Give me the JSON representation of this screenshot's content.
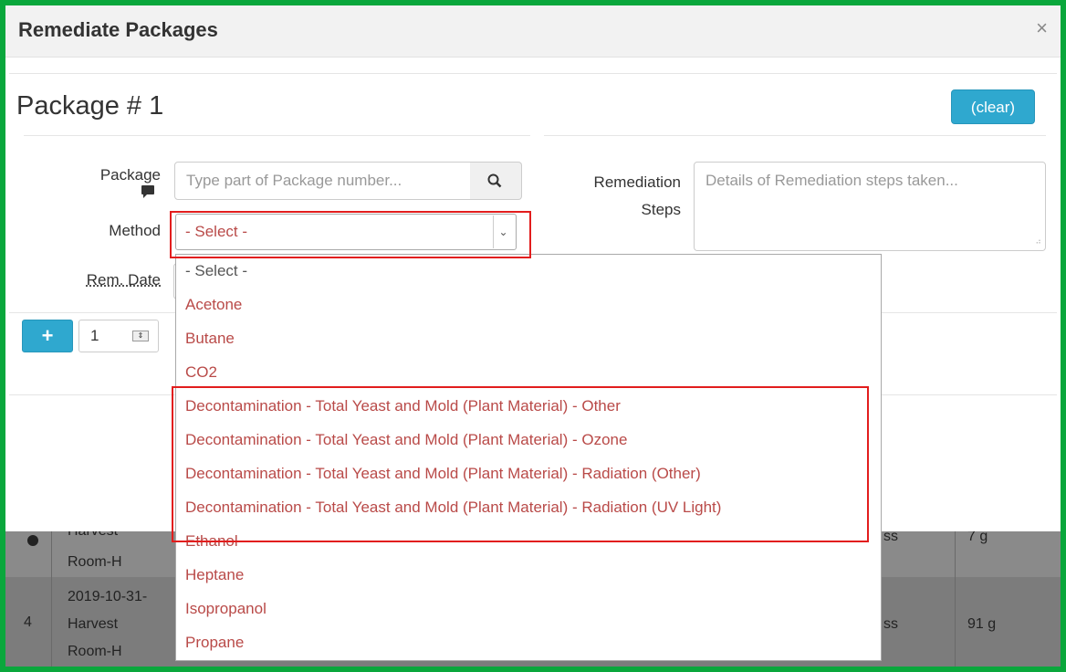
{
  "modal": {
    "title": "Remediate Packages",
    "close_glyph": "×"
  },
  "package_section": {
    "title": "Package # 1",
    "clear_label": "(clear)",
    "package_label": "Package",
    "package_placeholder": "Type part of Package number...",
    "method_label": "Method",
    "method_selected": "- Select -",
    "rem_date_label": "Rem. Date",
    "remediation_label_line1": "Remediation",
    "remediation_label_line2": "Steps",
    "remediation_placeholder": "Details of Remediation steps taken...",
    "add_count": "1"
  },
  "method_options": [
    "- Select -",
    "Acetone",
    "Butane",
    "CO2",
    "Decontamination - Total Yeast and Mold (Plant Material) - Other",
    "Decontamination - Total Yeast and Mold (Plant Material) - Ozone",
    "Decontamination - Total Yeast and Mold (Plant Material) - Radiation (Other)",
    "Decontamination - Total Yeast and Mold (Plant Material) - Radiation (UV Light)",
    "Ethanol",
    "Heptane",
    "Isopropanol",
    "Propane"
  ],
  "background_table": {
    "row1": {
      "harvest_line1": "Harvest",
      "harvest_line2": "Room-H",
      "weight": "7 g",
      "tail": "ss"
    },
    "row2": {
      "index": "4",
      "date_line1": "2019-10-31-",
      "date_line2": "Harvest",
      "date_line3": "Room-H",
      "tail": "ss",
      "weight": "91 g"
    }
  },
  "colors": {
    "accent_button": "#2fa8cf",
    "option_text": "#b94a48",
    "highlight_border": "#e21d1d",
    "frame_border": "#0aa73c"
  }
}
